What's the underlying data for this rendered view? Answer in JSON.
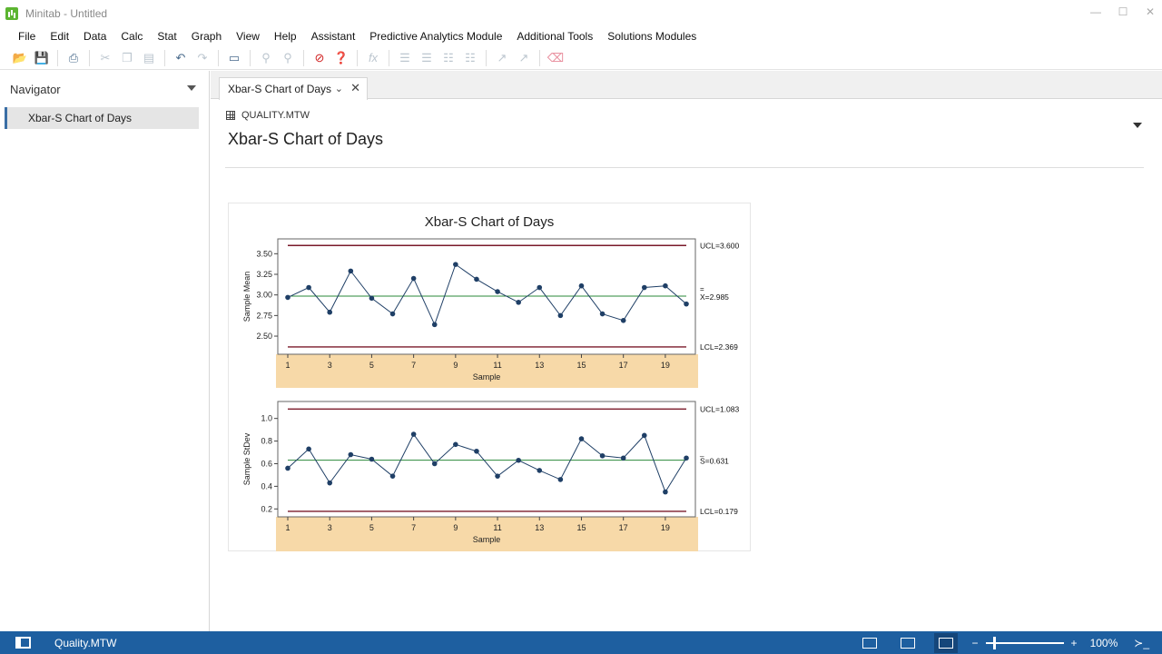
{
  "window": {
    "title": "Minitab - Untitled",
    "controls": [
      "—",
      "☐",
      "✕"
    ]
  },
  "menu": [
    "File",
    "Edit",
    "Data",
    "Calc",
    "Stat",
    "Graph",
    "View",
    "Help",
    "Assistant",
    "Predictive Analytics Module",
    "Additional Tools",
    "Solutions Modules"
  ],
  "toolbar": {
    "icons": [
      "open-icon",
      "save-icon",
      "print-icon",
      "cut-icon",
      "copy-icon",
      "paste-icon",
      "undo-icon",
      "redo-icon",
      "window-icon",
      "find-icon",
      "replace-icon",
      "cancel-icon",
      "help-icon",
      "formula-icon",
      "align-icon",
      "layout-icon",
      "tree-icon",
      "chart-brush-icon",
      "chart-edit-icon",
      "eraser-icon"
    ]
  },
  "navigator": {
    "title": "Navigator",
    "items": [
      "Xbar-S Chart of Days"
    ]
  },
  "tabs": [
    {
      "label": "Xbar-S Chart of Days"
    }
  ],
  "output": {
    "worksheet": "QUALITY.MTW",
    "title": "Xbar-S Chart of Days"
  },
  "chart_data": {
    "type": "line",
    "title": "Xbar-S Chart of Days",
    "band_color": "#f7d9a8",
    "panels": [
      {
        "ylabel": "Sample Mean",
        "xlabel": "Sample",
        "yticks": [
          "2.50",
          "2.75",
          "3.00",
          "3.25",
          "3.50"
        ],
        "ytick_values": [
          2.5,
          2.75,
          3.0,
          3.25,
          3.5
        ],
        "ylim": [
          2.28,
          3.68
        ],
        "xticks": [
          "1",
          "3",
          "5",
          "7",
          "9",
          "11",
          "13",
          "15",
          "17",
          "19"
        ],
        "values": [
          2.97,
          3.09,
          2.79,
          3.29,
          2.96,
          2.77,
          3.2,
          2.64,
          3.37,
          3.19,
          3.04,
          2.91,
          3.09,
          2.75,
          3.11,
          2.77,
          2.69,
          3.09,
          3.11,
          2.89
        ],
        "ucl": {
          "value": 3.6,
          "label": "UCL=3.600"
        },
        "center": {
          "value": 2.985,
          "bar": "=",
          "label": "X=2.985"
        },
        "lcl": {
          "value": 2.369,
          "label": "LCL=2.369"
        }
      },
      {
        "ylabel": "Sample StDev",
        "xlabel": "Sample",
        "yticks": [
          "0.2",
          "0.4",
          "0.6",
          "0.8",
          "1.0"
        ],
        "ytick_values": [
          0.2,
          0.4,
          0.6,
          0.8,
          1.0
        ],
        "ylim": [
          0.13,
          1.15
        ],
        "xticks": [
          "1",
          "3",
          "5",
          "7",
          "9",
          "11",
          "13",
          "15",
          "17",
          "19"
        ],
        "values": [
          0.56,
          0.73,
          0.43,
          0.68,
          0.64,
          0.49,
          0.86,
          0.6,
          0.77,
          0.71,
          0.49,
          0.63,
          0.54,
          0.46,
          0.82,
          0.67,
          0.65,
          0.85,
          0.35,
          0.65
        ],
        "ucl": {
          "value": 1.083,
          "label": "UCL=1.083"
        },
        "center": {
          "value": 0.631,
          "bar": "_",
          "label": "S=0.631"
        },
        "lcl": {
          "value": 0.179,
          "label": "LCL=0.179"
        }
      }
    ]
  },
  "statusbar": {
    "file": "Quality.MTW",
    "zoom": "100%",
    "zoom_level": 0.1,
    "zoom_minus": "−",
    "zoom_plus": "+",
    "cmd": "≻_"
  }
}
